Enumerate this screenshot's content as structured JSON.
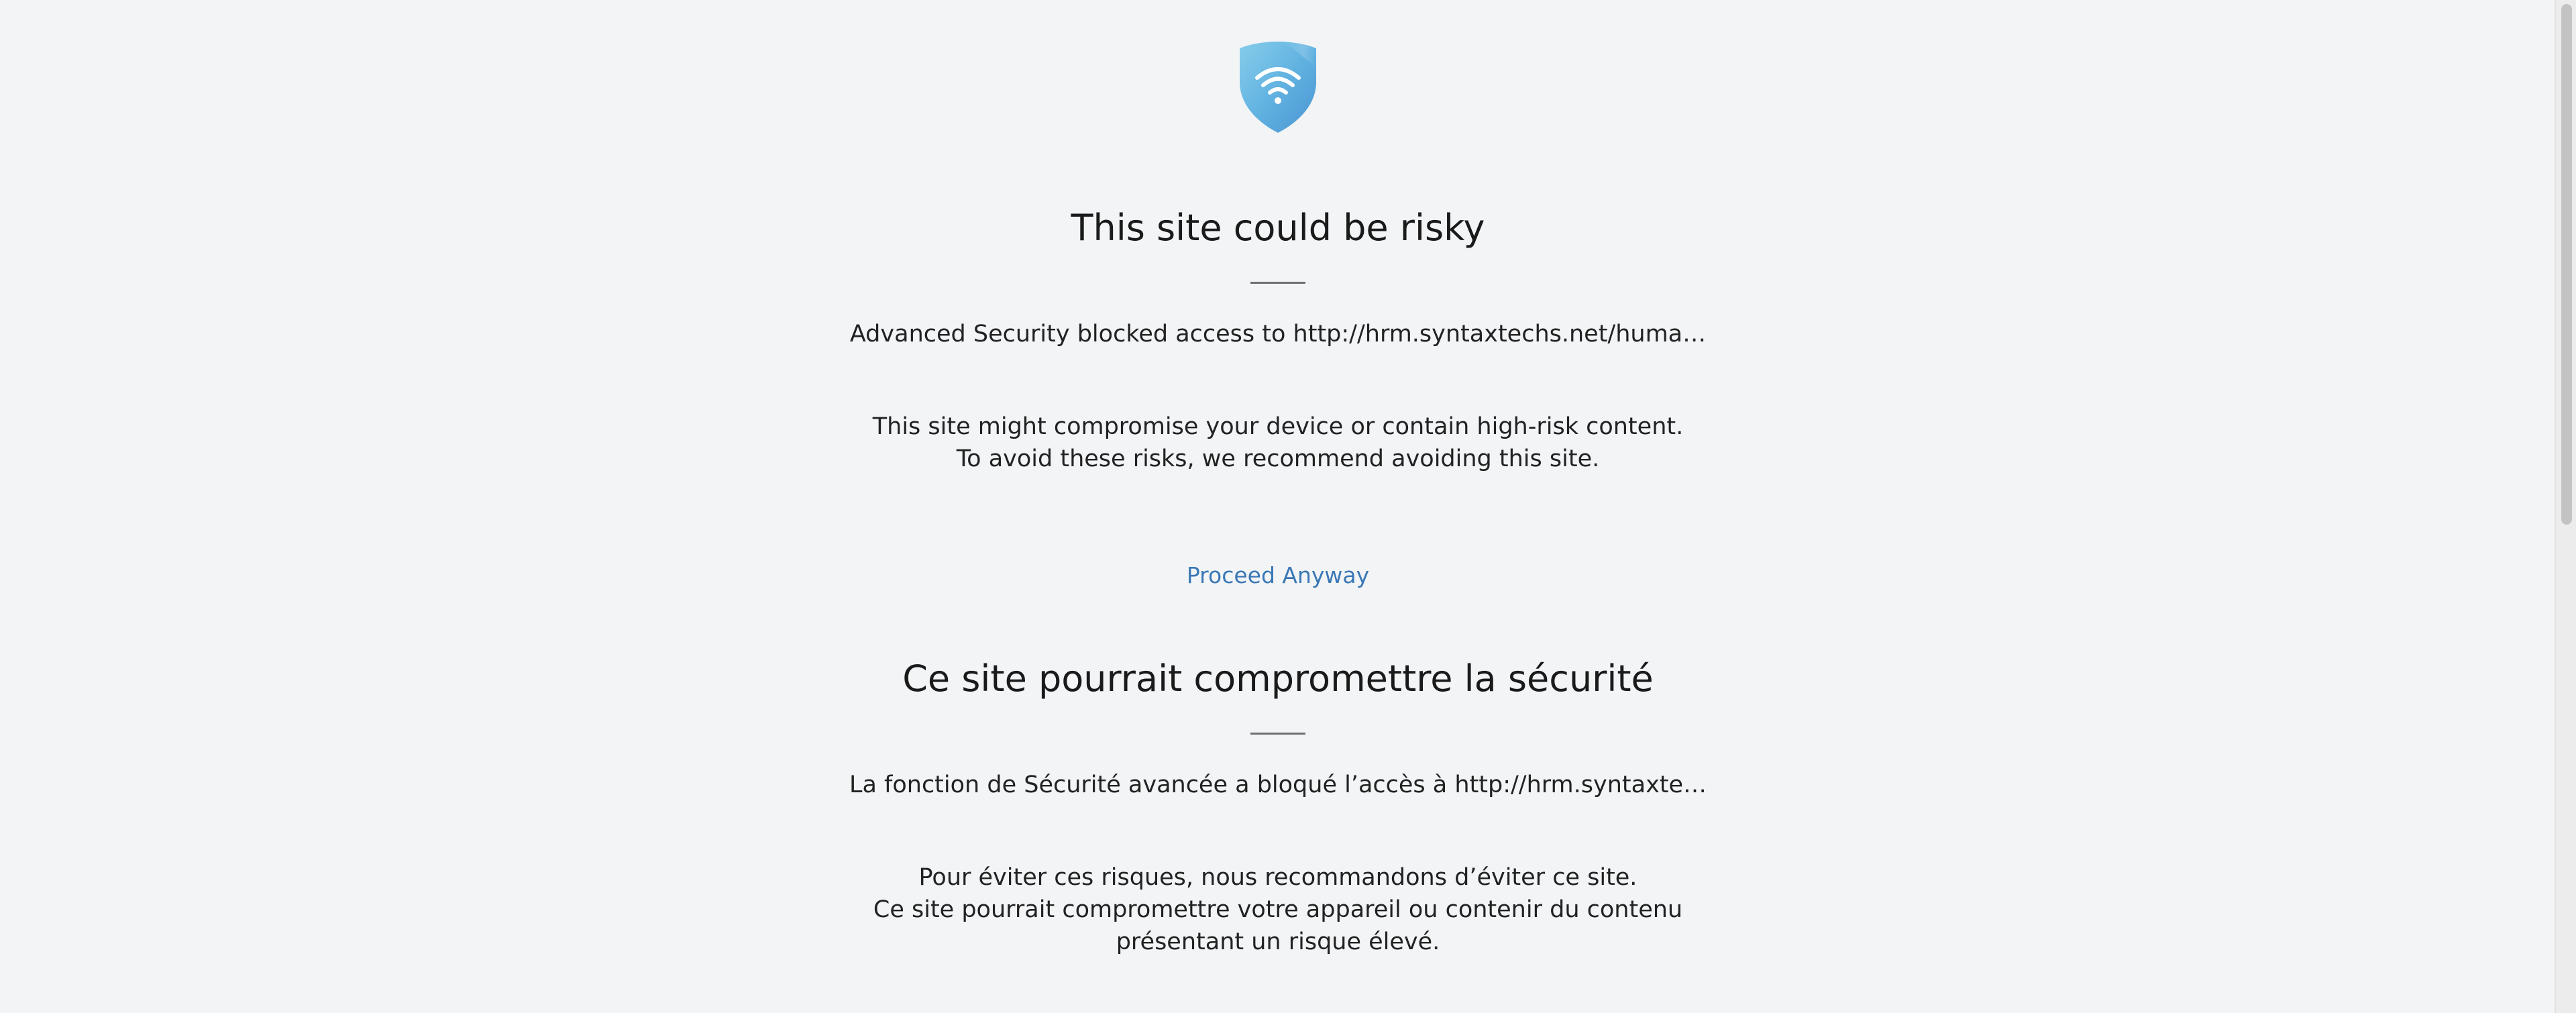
{
  "icon": "shield-wifi-icon",
  "colors": {
    "background": "#f2f4f6",
    "link": "#3a78b5",
    "shield_top": "#7cc4e6",
    "shield_bottom": "#4a9ad6"
  },
  "english": {
    "title": "This site could be risky",
    "blocked_message": "Advanced Security blocked access to http://hrm.syntaxtechs.net/huma…",
    "description_line1": "This site might compromise your device or contain high-risk content.",
    "description_line2": "To avoid these risks, we recommend avoiding this site.",
    "proceed_label": "Proceed Anyway"
  },
  "french": {
    "title": "Ce site pourrait compromettre la sécurité",
    "blocked_message": "La fonction de Sécurité avancée a bloqué l’accès à http://hrm.syntaxte…",
    "description_line1": "Pour éviter ces risques, nous recommandons d’éviter ce site.",
    "description_line2": "Ce site pourrait compromettre votre appareil ou contenir du contenu",
    "description_line3": "présentant un risque élevé."
  }
}
